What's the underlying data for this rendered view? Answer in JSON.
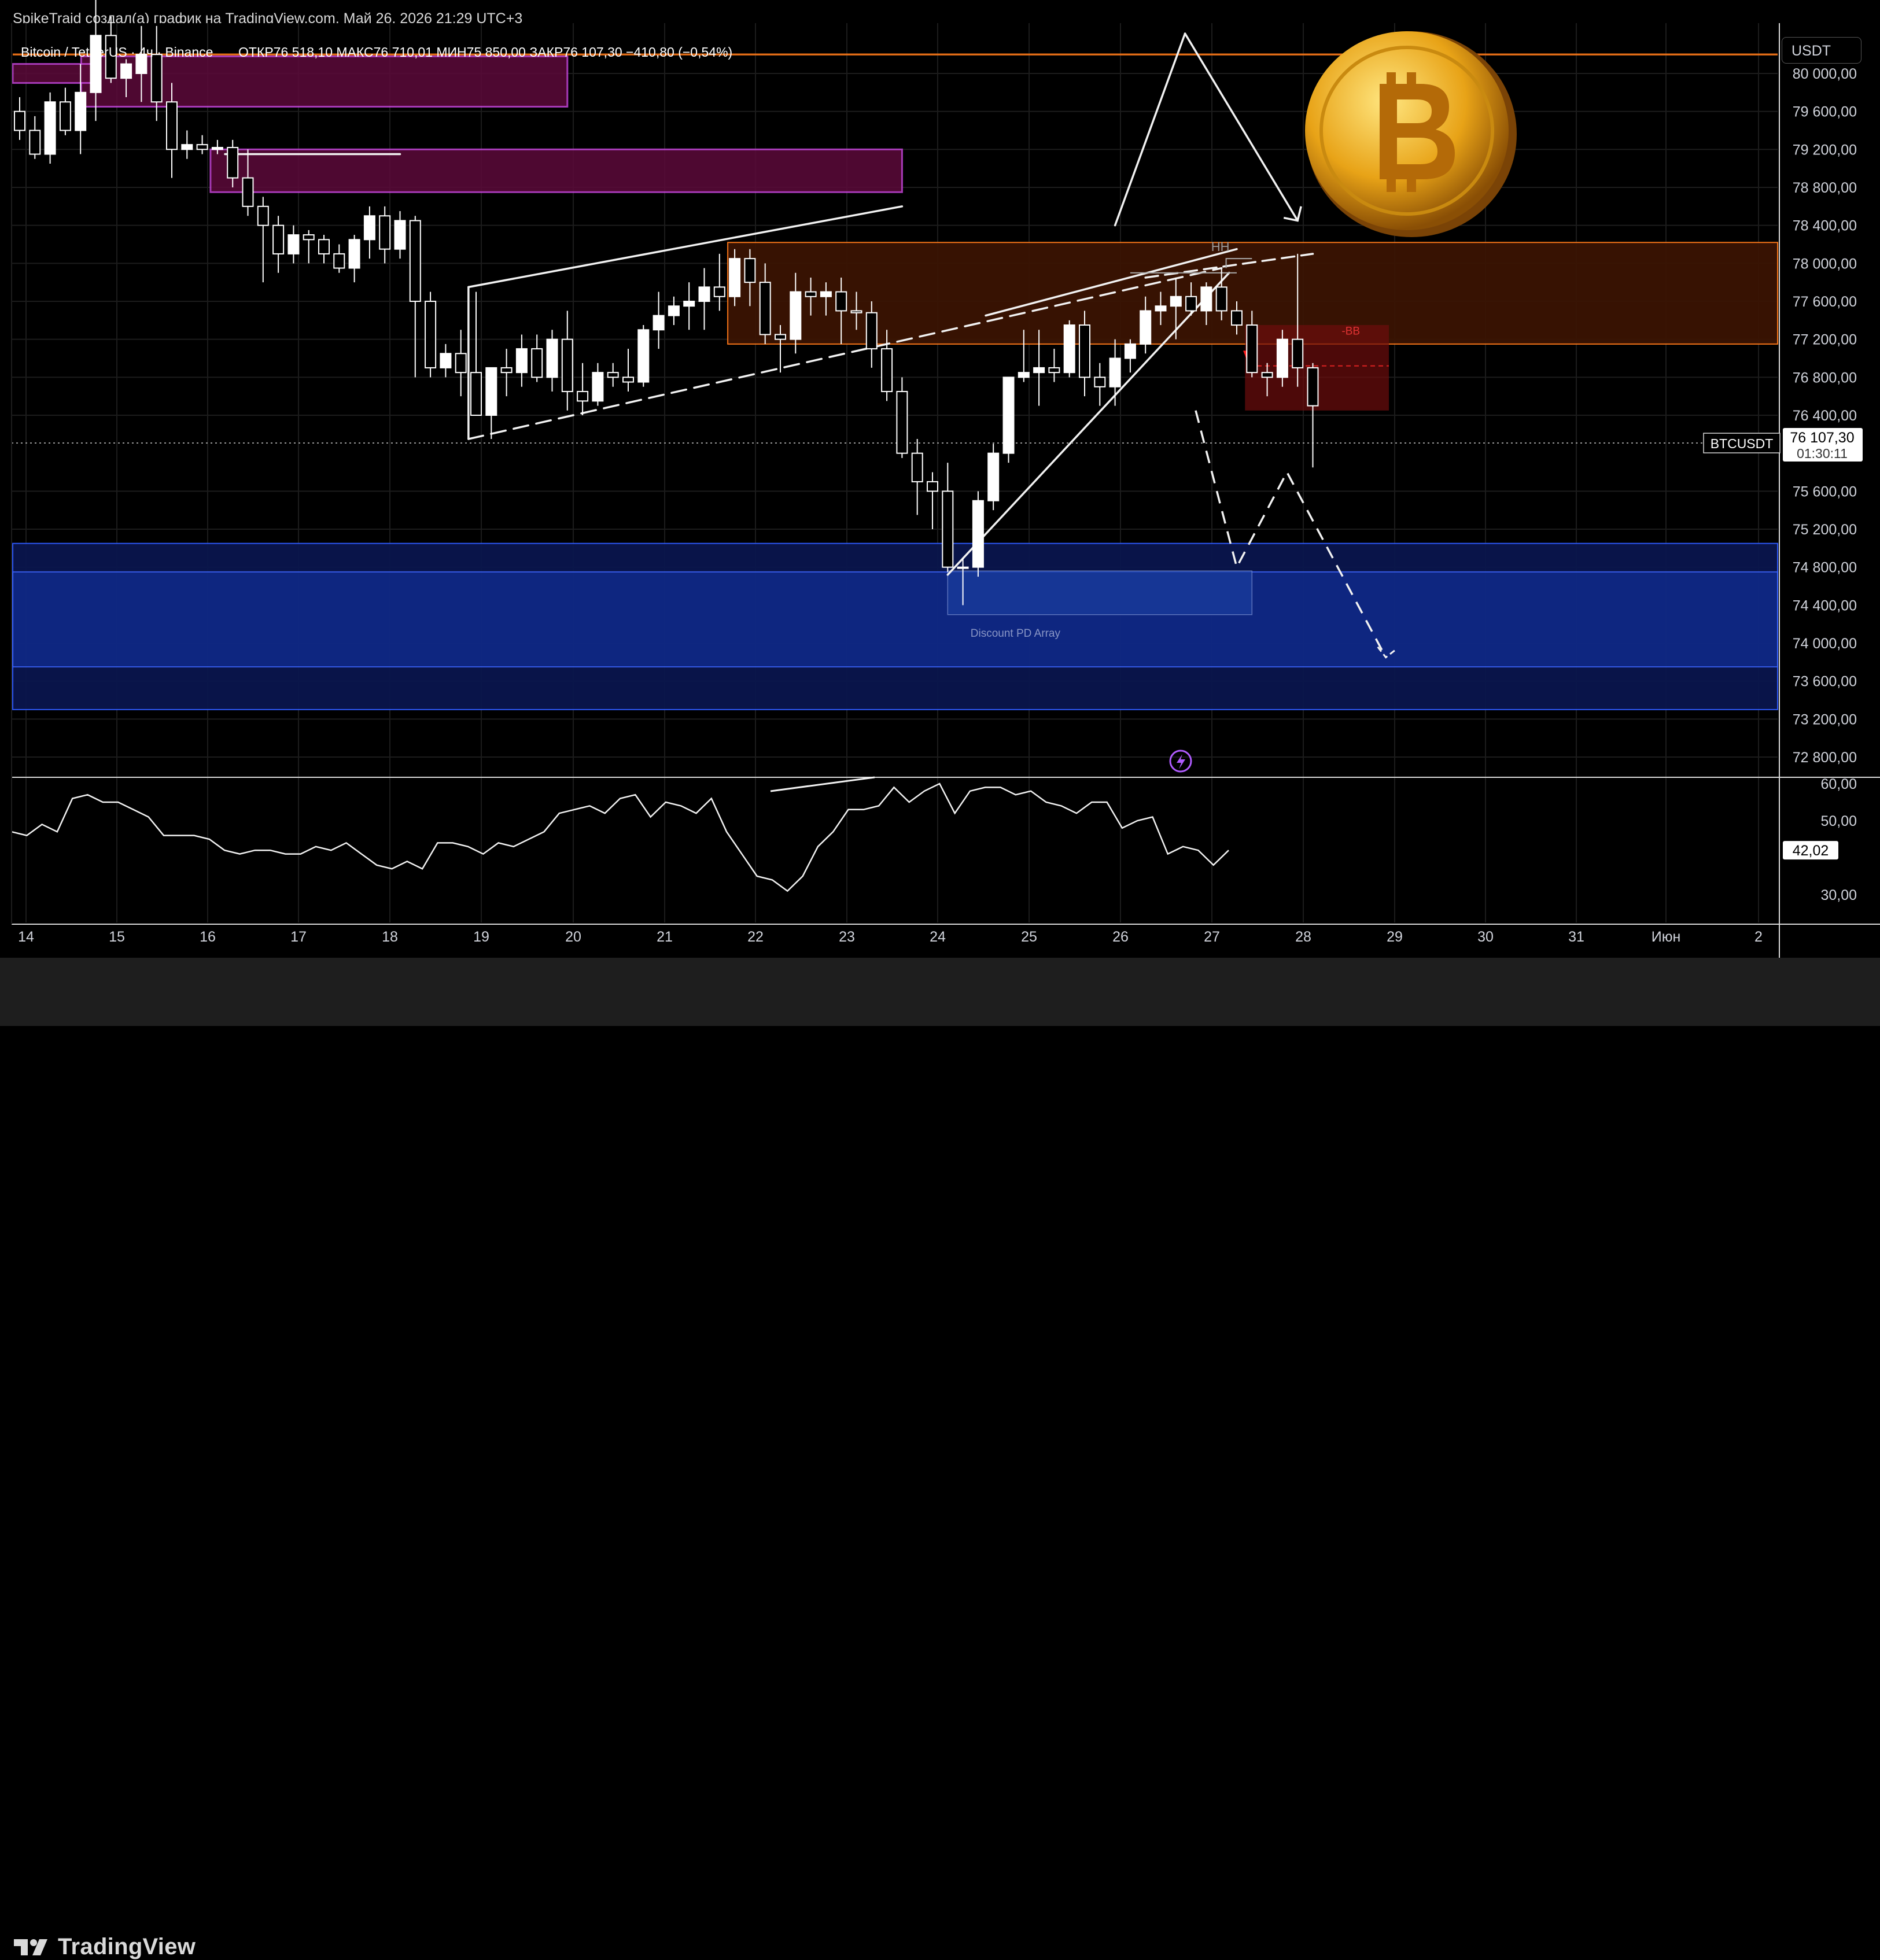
{
  "header": {
    "attribution": "SpikeTraid создал(а) график на TradingView.com, Май 26, 2026 21:29 UTC+3"
  },
  "legend": {
    "symbol": "Bitcoin / TetherUS · 4ч · Binance",
    "ohlc": "ОТКР76 518,10  МАКС76 710,01  МИН75 850,00  ЗАКР76 107,30  −410,80 (−0,54%)"
  },
  "price_axis": {
    "currency": "USDT",
    "ticks": [
      "80 000,00",
      "79 600,00",
      "79 200,00",
      "78 800,00",
      "78 400,00",
      "78 000,00",
      "77 600,00",
      "77 200,00",
      "76 800,00",
      "76 400,00",
      "75 600,00",
      "75 200,00",
      "74 800,00",
      "74 400,00",
      "74 000,00",
      "73 600,00",
      "73 200,00",
      "72 800,00"
    ],
    "tick_values": [
      80000,
      79600,
      79200,
      78800,
      78400,
      78000,
      77600,
      77200,
      76800,
      76400,
      75600,
      75200,
      74800,
      74400,
      74000,
      73600,
      73200,
      72800
    ],
    "last_price_label": "BTCUSDT",
    "last_price": "76 107,30",
    "last_price_value": 76107.3,
    "countdown": "01:30:11"
  },
  "rsi_axis": {
    "ticks": [
      "60,00",
      "50,00",
      "30,00"
    ],
    "tick_values": [
      60,
      50,
      30
    ],
    "current": "42,02",
    "current_value": 42.02
  },
  "time_axis": {
    "labels": [
      "14",
      "15",
      "16",
      "17",
      "18",
      "19",
      "20",
      "21",
      "22",
      "23",
      "24",
      "25",
      "26",
      "27",
      "28",
      "29",
      "30",
      "31",
      "Июн",
      "2"
    ]
  },
  "annotations": {
    "hh": "HH",
    "bb": "-BB",
    "discount": "Discount PD Array"
  },
  "branding": {
    "logo_text": "TradingView"
  },
  "colors": {
    "bull": "#ffffff",
    "bear": "#ffffff",
    "supply_zone": "#ff6a00",
    "magenta_zone": "#e040fb",
    "demand_zone": "#2962ff",
    "background": "#000000"
  },
  "chart_data": {
    "type": "candlestick",
    "title": "Bitcoin / TetherUS · 4ч · Binance",
    "xlabel": "",
    "ylabel": "",
    "ylim": [
      72600,
      80400
    ],
    "timeframe": "4h",
    "x_day_labels": [
      "14",
      "15",
      "16",
      "17",
      "18",
      "19",
      "20",
      "21",
      "22",
      "23",
      "24",
      "25",
      "26",
      "27",
      "28",
      "29",
      "30",
      "31",
      "Июн",
      "2"
    ],
    "candles": [
      [
        79600,
        79750,
        79300,
        79400
      ],
      [
        79400,
        79550,
        79100,
        79150
      ],
      [
        79150,
        79800,
        79050,
        79700
      ],
      [
        79700,
        79850,
        79350,
        79400
      ],
      [
        79400,
        80100,
        79150,
        79800
      ],
      [
        79800,
        81500,
        79500,
        80400
      ],
      [
        80400,
        80600,
        79900,
        79950
      ],
      [
        79950,
        80150,
        79750,
        80100
      ],
      [
        80000,
        80500,
        79700,
        80200
      ],
      [
        80200,
        80500,
        79500,
        79700
      ],
      [
        79700,
        79900,
        78900,
        79200
      ],
      [
        79200,
        79400,
        79100,
        79250
      ],
      [
        79250,
        79350,
        79150,
        79200
      ],
      [
        79200,
        79300,
        79150,
        79220
      ],
      [
        79220,
        79300,
        78800,
        78900
      ],
      [
        78900,
        79200,
        78500,
        78600
      ],
      [
        78600,
        78700,
        77800,
        78400
      ],
      [
        78400,
        78500,
        77900,
        78100
      ],
      [
        78100,
        78400,
        78000,
        78300
      ],
      [
        78300,
        78350,
        78000,
        78250
      ],
      [
        78250,
        78300,
        78000,
        78100
      ],
      [
        78100,
        78200,
        77900,
        77950
      ],
      [
        77950,
        78300,
        77800,
        78250
      ],
      [
        78250,
        78600,
        78050,
        78500
      ],
      [
        78500,
        78600,
        78000,
        78150
      ],
      [
        78150,
        78550,
        78050,
        78450
      ],
      [
        78450,
        78500,
        76800,
        77600
      ],
      [
        77600,
        77700,
        76800,
        76900
      ],
      [
        76900,
        77150,
        76800,
        77050
      ],
      [
        77050,
        77300,
        76600,
        76850
      ],
      [
        76850,
        77700,
        76400,
        76400
      ],
      [
        76400,
        76500,
        76150,
        76900
      ],
      [
        76900,
        77100,
        76600,
        76850
      ],
      [
        76850,
        77250,
        76700,
        77100
      ],
      [
        77100,
        77250,
        76750,
        76800
      ],
      [
        76800,
        77300,
        76650,
        77200
      ],
      [
        77200,
        77500,
        76450,
        76650
      ],
      [
        76650,
        76950,
        76400,
        76550
      ],
      [
        76550,
        76950,
        76500,
        76850
      ],
      [
        76850,
        76950,
        76700,
        76800
      ],
      [
        76800,
        77100,
        76650,
        76750
      ],
      [
        76750,
        77350,
        76700,
        77300
      ],
      [
        77300,
        77700,
        77100,
        77450
      ],
      [
        77450,
        77650,
        77350,
        77550
      ],
      [
        77550,
        77800,
        77300,
        77600
      ],
      [
        77600,
        77950,
        77300,
        77750
      ],
      [
        77750,
        78100,
        77500,
        77650
      ],
      [
        77650,
        78150,
        77550,
        78050
      ],
      [
        78050,
        78150,
        77550,
        77800
      ],
      [
        77800,
        78000,
        77150,
        77250
      ],
      [
        77250,
        77350,
        76850,
        77200
      ],
      [
        77200,
        77900,
        77050,
        77700
      ],
      [
        77700,
        77850,
        77450,
        77650
      ],
      [
        77650,
        77800,
        77450,
        77700
      ],
      [
        77700,
        77850,
        77150,
        77500
      ],
      [
        77500,
        77700,
        77300,
        77480
      ],
      [
        77480,
        77600,
        76900,
        77100
      ],
      [
        77100,
        77300,
        76550,
        76650
      ],
      [
        76650,
        76800,
        75950,
        76000
      ],
      [
        76000,
        76150,
        75350,
        75700
      ],
      [
        75700,
        75800,
        75200,
        75600
      ],
      [
        75600,
        75900,
        74750,
        74800
      ],
      [
        74800,
        74900,
        74400,
        74800
      ],
      [
        74800,
        75600,
        74700,
        75500
      ],
      [
        75500,
        76100,
        75400,
        76000
      ],
      [
        76000,
        76800,
        75900,
        76800
      ],
      [
        76800,
        77300,
        76750,
        76850
      ],
      [
        76850,
        77300,
        76500,
        76900
      ],
      [
        76900,
        77100,
        76750,
        76850
      ],
      [
        76850,
        77400,
        76800,
        77350
      ],
      [
        77350,
        77500,
        76600,
        76800
      ],
      [
        76800,
        76950,
        76500,
        76700
      ],
      [
        76700,
        77200,
        76500,
        77000
      ],
      [
        77000,
        77200,
        76850,
        77150
      ],
      [
        77150,
        77650,
        77050,
        77500
      ],
      [
        77500,
        77700,
        77350,
        77550
      ],
      [
        77550,
        77850,
        77200,
        77650
      ],
      [
        77650,
        77800,
        77450,
        77500
      ],
      [
        77500,
        77800,
        77350,
        77750
      ],
      [
        77750,
        77950,
        77400,
        77500
      ],
      [
        77500,
        77600,
        77250,
        77350
      ],
      [
        77350,
        77500,
        76800,
        76850
      ],
      [
        76850,
        76950,
        76600,
        76800
      ],
      [
        76800,
        77300,
        76700,
        77200
      ],
      [
        77200,
        78100,
        76700,
        76900
      ],
      [
        76900,
        76950,
        75850,
        76500
      ]
    ],
    "rsi": {
      "name": "",
      "values": [
        47,
        46,
        49,
        47,
        56,
        57,
        55,
        55,
        53,
        51,
        46,
        46,
        46,
        45,
        42,
        41,
        42,
        42,
        41,
        41,
        43,
        42,
        44,
        41,
        38,
        37,
        39,
        37,
        44,
        44,
        43,
        41,
        44,
        43,
        45,
        47,
        52,
        53,
        54,
        52,
        56,
        57,
        51,
        55,
        54,
        52,
        56,
        47,
        41,
        35,
        34,
        31,
        35,
        43,
        47,
        53,
        53,
        54,
        59,
        55,
        58,
        60,
        52,
        58,
        59,
        59,
        57,
        58,
        55,
        54,
        52,
        55,
        55,
        48,
        50,
        51,
        41,
        43,
        42,
        38,
        42
      ]
    },
    "zones": [
      {
        "kind": "magenta",
        "from_candle": 4.5,
        "to_candle": 36,
        "low": 79650,
        "high": 80180
      },
      {
        "kind": "magenta",
        "from_candle": 0,
        "to_candle": 5,
        "low": 79900,
        "high": 80100
      },
      {
        "kind": "magenta",
        "from_candle": 13,
        "to_candle": 58,
        "low": 78750,
        "high": 79200
      },
      {
        "kind": "supply",
        "from_candle": 47,
        "to_candle": 120,
        "low": 77150,
        "high": 78220
      },
      {
        "kind": "supply-line",
        "from_candle": 0,
        "to_candle": 120,
        "low": 80190,
        "high": 80210
      },
      {
        "kind": "bb",
        "from_candle": 81,
        "to_candle": 90,
        "low": 76450,
        "high": 77350
      },
      {
        "kind": "demand",
        "from_candle": 0,
        "to_candle": 120,
        "low": 73300,
        "high": 75050
      },
      {
        "kind": "demand-inner",
        "from_candle": 0,
        "to_candle": 120,
        "low": 73750,
        "high": 74750
      }
    ]
  }
}
